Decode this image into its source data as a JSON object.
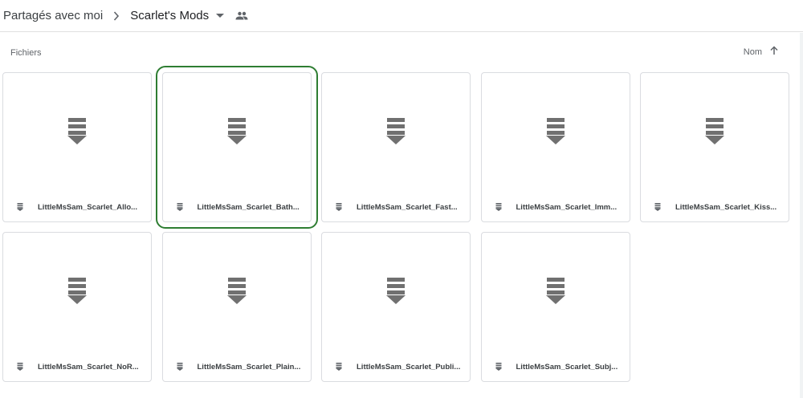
{
  "breadcrumb": {
    "parent": "Partagés avec moi",
    "current": "Scarlet's Mods"
  },
  "section": {
    "label": "Fichiers",
    "sort_label": "Nom"
  },
  "colors": {
    "selected_outline": "#2e7d32",
    "icon_gray": "#707070"
  },
  "files": [
    {
      "name": "LittleMsSam_Scarlet_Allo...",
      "icon": "file-icon",
      "selected": false
    },
    {
      "name": "LittleMsSam_Scarlet_Bath...",
      "icon": "file-icon",
      "selected": true
    },
    {
      "name": "LittleMsSam_Scarlet_Fast...",
      "icon": "file-icon",
      "selected": false
    },
    {
      "name": "LittleMsSam_Scarlet_Imm...",
      "icon": "file-icon",
      "selected": false
    },
    {
      "name": "LittleMsSam_Scarlet_Kiss...",
      "icon": "file-icon",
      "selected": false
    },
    {
      "name": "LittleMsSam_Scarlet_NoR...",
      "icon": "file-icon",
      "selected": false
    },
    {
      "name": "LittleMsSam_Scarlet_Plain...",
      "icon": "file-icon",
      "selected": false
    },
    {
      "name": "LittleMsSam_Scarlet_Publi...",
      "icon": "file-icon",
      "selected": false
    },
    {
      "name": "LittleMsSam_Scarlet_Subj...",
      "icon": "file-icon",
      "selected": false
    }
  ]
}
